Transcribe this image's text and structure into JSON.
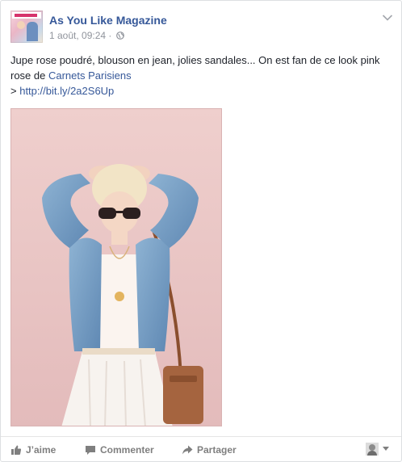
{
  "post": {
    "page_name": "As You Like Magazine",
    "timestamp": "1 août, 09:24",
    "separator": " · ",
    "privacy_icon": "globe-icon",
    "menu_icon": "chevron-down-icon",
    "text_part1": "Jupe rose poudré, blouson en jean, jolies sandales... On est fan de ce look pink rose de ",
    "mention": "Carnets Parisiens",
    "link_prefix": "> ",
    "link": "http://bit.ly/2a2S6Up"
  },
  "actions": {
    "like_label": "J’aime",
    "comment_label": "Commenter",
    "share_label": "Partager",
    "like_icon": "thumbs-up-icon",
    "comment_icon": "speech-bubble-icon",
    "share_icon": "share-arrow-icon"
  },
  "colors": {
    "link": "#365899",
    "meta": "#90949c",
    "photo_background": "#e9c7c6",
    "action_text": "#7f7f7f"
  }
}
